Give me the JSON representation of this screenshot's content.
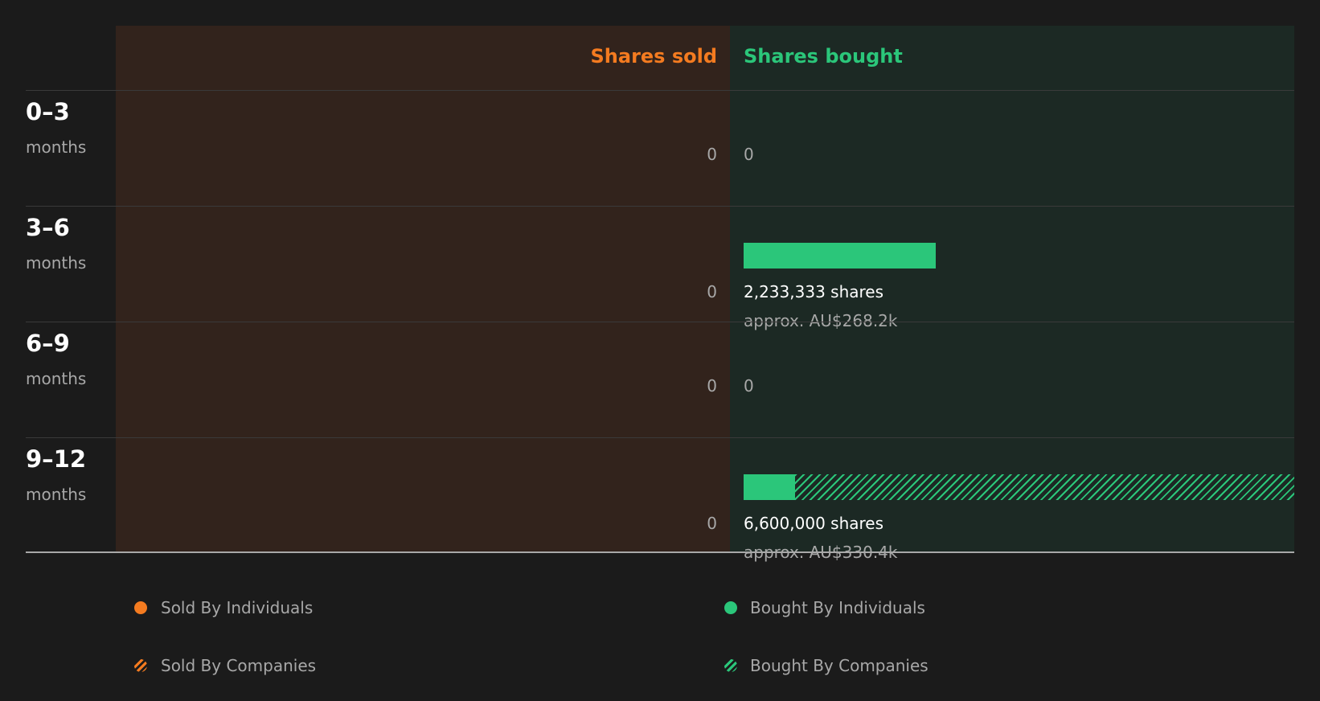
{
  "chart_data": {
    "type": "bar",
    "columns": {
      "sold": {
        "label": "Shares sold",
        "color": "#f47b20"
      },
      "bought": {
        "label": "Shares bought",
        "color": "#2bc67a"
      }
    },
    "categories": [
      {
        "range": "0–3",
        "unit": "months"
      },
      {
        "range": "3–6",
        "unit": "months"
      },
      {
        "range": "6–9",
        "unit": "months"
      },
      {
        "range": "9–12",
        "unit": "months"
      }
    ],
    "series": [
      {
        "name": "Sold By Individuals",
        "values": [
          0,
          0,
          0,
          0
        ]
      },
      {
        "name": "Sold By Companies",
        "values": [
          0,
          0,
          0,
          0
        ]
      },
      {
        "name": "Bought By Individuals",
        "values": [
          0,
          2233333,
          0,
          600000
        ]
      },
      {
        "name": "Bought By Companies",
        "values": [
          0,
          0,
          0,
          6000000
        ]
      }
    ],
    "sold_labels": [
      "0",
      "0",
      "0",
      "0"
    ],
    "bought_labels": [
      {
        "zero": "0"
      },
      {
        "shares": "2,233,333 shares",
        "approx": "approx. AU$268.2k"
      },
      {
        "zero": "0"
      },
      {
        "shares": "6,600,000 shares",
        "approx": "approx. AU$330.4k"
      }
    ],
    "legend": {
      "sold_individuals": "Sold By Individuals",
      "sold_companies": "Sold By Companies",
      "bought_individuals": "Bought By Individuals",
      "bought_companies": "Bought By Companies"
    }
  }
}
